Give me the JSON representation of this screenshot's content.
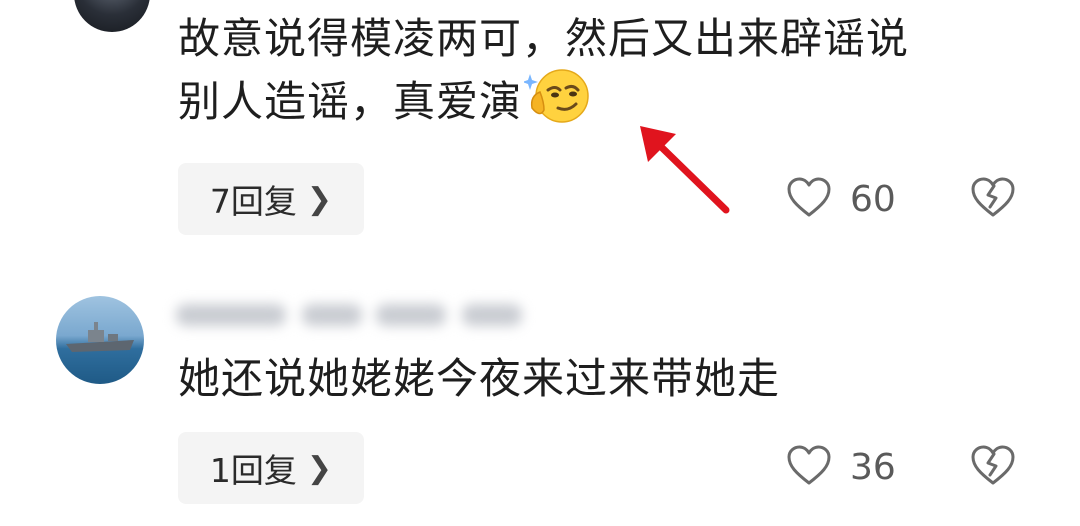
{
  "comments": [
    {
      "text_line1": "故意说得模凌两可，然后又出来辟谣说",
      "text_line2": "别人造谣，真爱演",
      "emoji": "smirk-thinking-emoji",
      "replies_label": "7回复",
      "likes": "60"
    },
    {
      "text": "她还说她姥姥今夜来过来带她走",
      "replies_label": "1回复",
      "likes": "36"
    }
  ],
  "icons": {
    "reply_chevron": "chevron-right-icon",
    "like": "heart-outline-icon",
    "dislike": "broken-heart-icon",
    "annotation": "red-arrow"
  },
  "colors": {
    "text": "#1e1e1e",
    "reply_bg": "#f4f4f4",
    "meta": "#5a5a5a",
    "arrow": "#e0141e"
  }
}
